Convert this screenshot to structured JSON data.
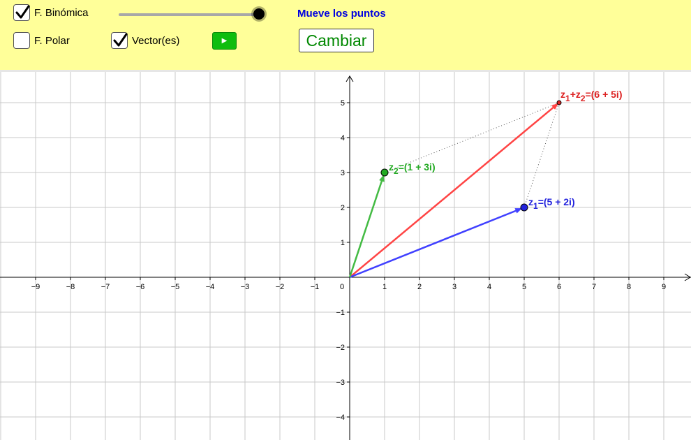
{
  "toolbar": {
    "binomica": {
      "label": "F. Binómica",
      "checked": true
    },
    "polar": {
      "label": "F. Polar",
      "checked": false
    },
    "vectores": {
      "label": "Vector(es)",
      "checked": true
    },
    "slider_value": 1.0,
    "play_icon": "play-icon",
    "hint": "Mueve los puntos",
    "cambiar_label": "Cambiar"
  },
  "graph": {
    "x_ticks": [
      "−9",
      "−8",
      "−7",
      "−6",
      "−5",
      "−4",
      "−3",
      "−2",
      "−1",
      "0",
      "1",
      "2",
      "3",
      "4",
      "5",
      "6",
      "7",
      "8",
      "9"
    ],
    "y_ticks_pos": [
      "1",
      "2",
      "3",
      "4",
      "5"
    ],
    "y_ticks_neg": [
      "−1",
      "−2",
      "−3",
      "−4"
    ]
  },
  "chart_data": {
    "type": "scatter",
    "xlim": [
      -10,
      10
    ],
    "ylim": [
      -4.6,
      5.8
    ],
    "grid": true,
    "points": [
      {
        "name": "z1",
        "x": 5,
        "y": 2,
        "color": "#2222dd",
        "label_base": "z",
        "label_sub": "1",
        "label_text": "=(5 + 2i)"
      },
      {
        "name": "z2",
        "x": 1,
        "y": 3,
        "color": "#22aa22",
        "label_base": "z",
        "label_sub": "2",
        "label_text": "=(1 + 3i)"
      },
      {
        "name": "sum",
        "x": 6,
        "y": 5,
        "color": "#dd2222",
        "label_text": "=(6 + 5i)"
      }
    ],
    "sum_label_parts": [
      "z",
      "1",
      "+z",
      "2",
      "=(6 + 5i)"
    ]
  },
  "colors": {
    "blue": "#4040ff",
    "green": "#44bb44",
    "red": "#ff4444",
    "toolbar_bg": "#ffff99"
  }
}
